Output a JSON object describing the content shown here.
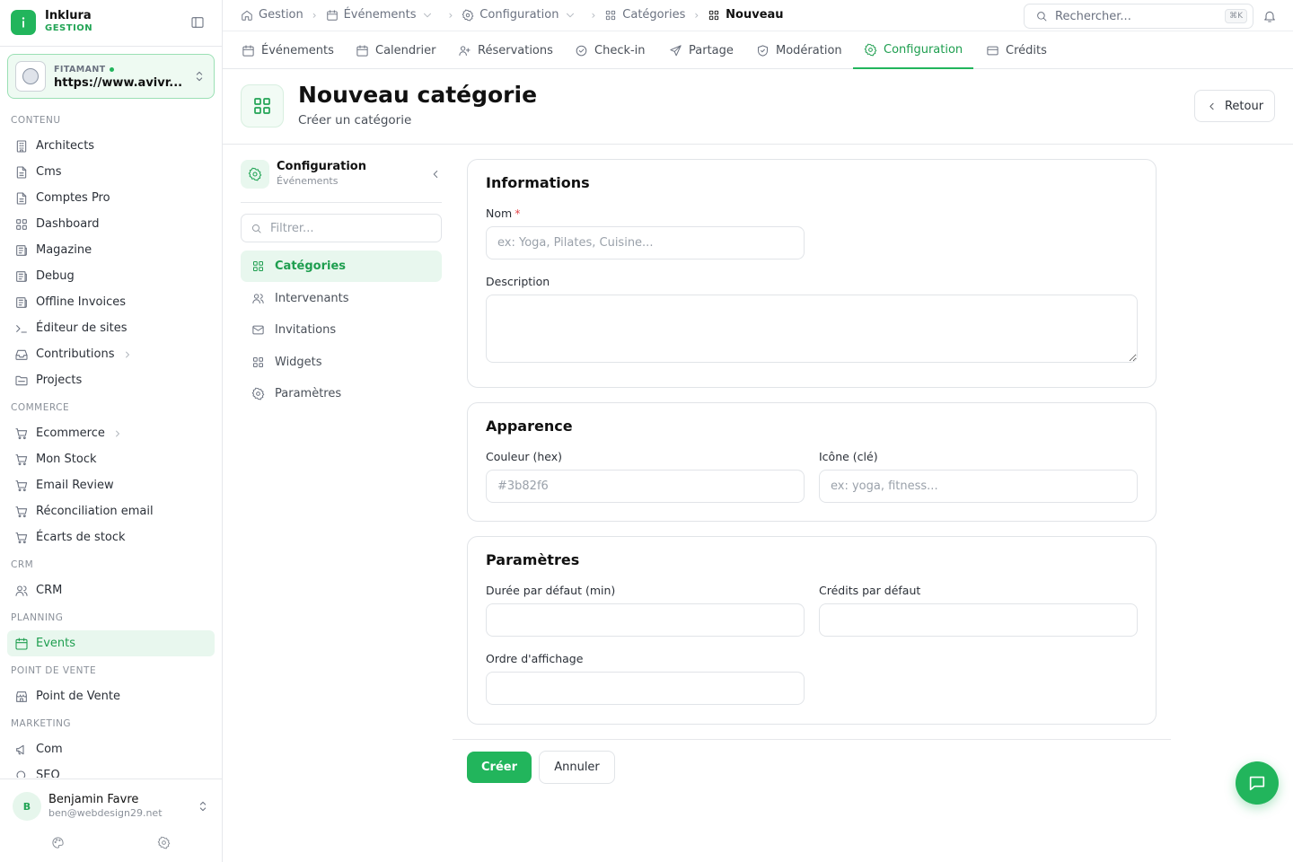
{
  "brand": {
    "name": "Inklura",
    "sub": "GESTION"
  },
  "tenant": {
    "label": "FITAMANT",
    "url": "https://www.avivr..."
  },
  "sidebar": {
    "sections": [
      {
        "title": "CONTENU",
        "items": [
          {
            "label": "Architects",
            "icon": "building-icon"
          },
          {
            "label": "Cms",
            "icon": "file-icon"
          },
          {
            "label": "Comptes Pro",
            "icon": "file-icon"
          },
          {
            "label": "Dashboard",
            "icon": "grid-icon"
          },
          {
            "label": "Magazine",
            "icon": "newspaper-icon"
          },
          {
            "label": "Debug",
            "icon": "newspaper-icon"
          },
          {
            "label": "Offline Invoices",
            "icon": "newspaper-icon"
          },
          {
            "label": "Éditeur de sites",
            "icon": "terminal-icon"
          },
          {
            "label": "Contributions",
            "icon": "inbox-icon",
            "chevron": true
          },
          {
            "label": "Projects",
            "icon": "folder-icon"
          }
        ]
      },
      {
        "title": "COMMERCE",
        "items": [
          {
            "label": "Ecommerce",
            "icon": "cart-icon",
            "chevron": true
          },
          {
            "label": "Mon Stock",
            "icon": "cart-icon"
          },
          {
            "label": "Email Review",
            "icon": "cart-icon"
          },
          {
            "label": "Réconciliation email",
            "icon": "cart-icon"
          },
          {
            "label": "Écarts de stock",
            "icon": "cart-icon"
          }
        ]
      },
      {
        "title": "CRM",
        "items": [
          {
            "label": "CRM",
            "icon": "users-icon"
          }
        ]
      },
      {
        "title": "PLANNING",
        "items": [
          {
            "label": "Events",
            "icon": "calendar-icon",
            "active": true
          }
        ]
      },
      {
        "title": "POINT DE VENTE",
        "items": [
          {
            "label": "Point de Vente",
            "icon": "store-icon"
          }
        ]
      },
      {
        "title": "MARKETING",
        "items": [
          {
            "label": "Com",
            "icon": "megaphone-icon"
          },
          {
            "label": "SEO",
            "icon": "search-icon"
          }
        ]
      }
    ]
  },
  "user": {
    "initial": "B",
    "name": "Benjamin Favre",
    "email": "ben@webdesign29.net"
  },
  "breadcrumb": {
    "items": [
      {
        "label": "Gestion",
        "icon": "home-icon"
      },
      {
        "label": "Événements",
        "icon": "calendar-icon",
        "dropdown": true
      },
      {
        "label": "Configuration",
        "icon": "gear-icon",
        "dropdown": true
      },
      {
        "label": "Catégories",
        "icon": "grid-icon"
      },
      {
        "label": "Nouveau",
        "icon": "grid-icon",
        "current": true
      }
    ]
  },
  "search": {
    "placeholder": "Rechercher...",
    "shortcut": "⌘K"
  },
  "tabs": [
    {
      "label": "Événements",
      "icon": "calendar-icon"
    },
    {
      "label": "Calendrier",
      "icon": "calendar-icon"
    },
    {
      "label": "Réservations",
      "icon": "user-plus-icon"
    },
    {
      "label": "Check-in",
      "icon": "check-circle-icon"
    },
    {
      "label": "Partage",
      "icon": "send-icon"
    },
    {
      "label": "Modération",
      "icon": "shield-icon"
    },
    {
      "label": "Configuration",
      "icon": "gear-icon",
      "active": true
    },
    {
      "label": "Crédits",
      "icon": "card-icon"
    }
  ],
  "page": {
    "title": "Nouveau catégorie",
    "subtitle": "Créer un catégorie",
    "back_label": "Retour"
  },
  "subnav": {
    "title": "Configuration",
    "subtitle": "Événements",
    "filter_placeholder": "Filtrer...",
    "items": [
      {
        "label": "Catégories",
        "icon": "grid-icon",
        "active": true
      },
      {
        "label": "Intervenants",
        "icon": "users-icon"
      },
      {
        "label": "Invitations",
        "icon": "mail-icon"
      },
      {
        "label": "Widgets",
        "icon": "grid-icon"
      },
      {
        "label": "Paramètres",
        "icon": "gear-icon"
      }
    ]
  },
  "form": {
    "informations": {
      "title": "Informations",
      "nom_label": "Nom",
      "nom_required": "*",
      "nom_placeholder": "ex: Yoga, Pilates, Cuisine...",
      "description_label": "Description"
    },
    "apparence": {
      "title": "Apparence",
      "couleur_label": "Couleur (hex)",
      "couleur_placeholder": "#3b82f6",
      "icone_label": "Icône (clé)",
      "icone_placeholder": "ex: yoga, fitness..."
    },
    "parametres": {
      "title": "Paramètres",
      "duree_label": "Durée par défaut (min)",
      "credits_label": "Crédits par défaut",
      "ordre_label": "Ordre d'affichage"
    },
    "submit_label": "Créer",
    "cancel_label": "Annuler"
  },
  "colors": {
    "accent": "#22b55c",
    "accent_text": "#1e9e4f",
    "accent_bg": "#e8f7ee",
    "required": "#e5484d"
  }
}
